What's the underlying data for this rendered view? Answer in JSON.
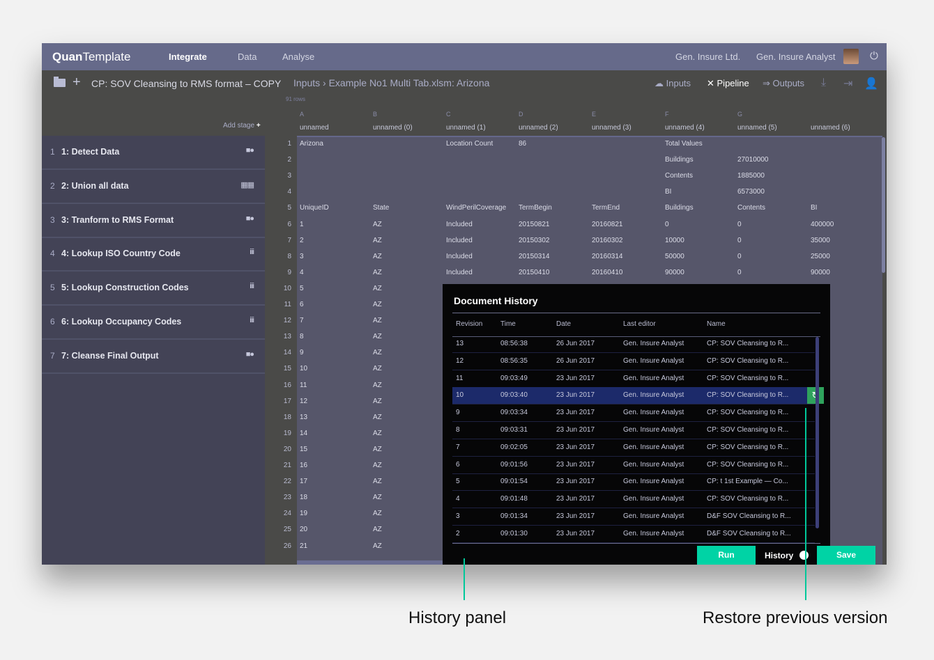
{
  "topbar": {
    "logo_bold": "Quan",
    "logo_light": "Template",
    "nav": [
      {
        "label": "Integrate",
        "active": true
      },
      {
        "label": "Data",
        "active": false
      },
      {
        "label": "Analyse",
        "active": false
      }
    ],
    "company": "Gen. Insure Ltd.",
    "user": "Gen. Insure Analyst",
    "power_icon": "power-icon"
  },
  "subbar": {
    "title": "CP: SOV Cleansing to RMS format – COPY",
    "breadcrumb": "Inputs › Example No1 Multi Tab.xlsm: Arizona",
    "tabs": [
      {
        "label": "Inputs",
        "icon": "cloud-upload-icon"
      },
      {
        "label": "Pipeline",
        "icon": "pipeline-icon",
        "active": true
      },
      {
        "label": "Outputs",
        "icon": "output-icon"
      }
    ]
  },
  "sidebar": {
    "add_stage": "Add stage",
    "stages": [
      {
        "num": "1",
        "label": "1: Detect Data",
        "icon": "transform-icon"
      },
      {
        "num": "2",
        "label": "2: Union all data",
        "icon": "union-icon"
      },
      {
        "num": "3",
        "label": "3: Tranform to RMS Format",
        "icon": "transform-icon"
      },
      {
        "num": "4",
        "label": "4: Lookup ISO Country Code",
        "icon": "lookup-icon"
      },
      {
        "num": "5",
        "label": "5: Lookup Construction Codes",
        "icon": "lookup-icon"
      },
      {
        "num": "6",
        "label": "6: Lookup Occupancy Codes",
        "icon": "lookup-icon"
      },
      {
        "num": "7",
        "label": "7: Cleanse Final Output",
        "icon": "transform-icon"
      }
    ]
  },
  "grid": {
    "row_count": "91 rows",
    "letters": [
      "A",
      "B",
      "C",
      "D",
      "E",
      "F",
      "G",
      ""
    ],
    "names": [
      "unnamed",
      "unnamed (0)",
      "unnamed (1)",
      "unnamed (2)",
      "unnamed (3)",
      "unnamed (4)",
      "unnamed (5)",
      "unnamed (6)"
    ],
    "rows": [
      [
        "Arizona",
        "",
        "Location Count",
        "86",
        "",
        "Total Values",
        "",
        ""
      ],
      [
        "",
        "",
        "",
        "",
        "",
        "Buildings",
        "27010000",
        ""
      ],
      [
        "",
        "",
        "",
        "",
        "",
        "Contents",
        "1885000",
        ""
      ],
      [
        "",
        "",
        "",
        "",
        "",
        "BI",
        "6573000",
        ""
      ],
      [
        "UniqueID",
        "State",
        "WindPerilCoverage",
        "TermBegin",
        "TermEnd",
        "Buildings",
        "Contents",
        "BI"
      ],
      [
        "1",
        "AZ",
        "Included",
        "20150821",
        "20160821",
        "0",
        "0",
        "400000"
      ],
      [
        "2",
        "AZ",
        "Included",
        "20150302",
        "20160302",
        "10000",
        "0",
        "35000"
      ],
      [
        "3",
        "AZ",
        "Included",
        "20150314",
        "20160314",
        "50000",
        "0",
        "25000"
      ],
      [
        "4",
        "AZ",
        "Included",
        "20150410",
        "20160410",
        "90000",
        "0",
        "90000"
      ],
      [
        "5",
        "AZ"
      ],
      [
        "6",
        "AZ"
      ],
      [
        "7",
        "AZ"
      ],
      [
        "8",
        "AZ"
      ],
      [
        "9",
        "AZ"
      ],
      [
        "10",
        "AZ"
      ],
      [
        "11",
        "AZ"
      ],
      [
        "12",
        "AZ"
      ],
      [
        "13",
        "AZ"
      ],
      [
        "14",
        "AZ"
      ],
      [
        "15",
        "AZ"
      ],
      [
        "16",
        "AZ"
      ],
      [
        "17",
        "AZ"
      ],
      [
        "18",
        "AZ"
      ],
      [
        "19",
        "AZ"
      ],
      [
        "20",
        "AZ"
      ],
      [
        "21",
        "AZ"
      ]
    ]
  },
  "history": {
    "title": "Document History",
    "headers": [
      "Revision",
      "Time",
      "Date",
      "Last editor",
      "Name"
    ],
    "rows": [
      {
        "rev": "13",
        "time": "08:56:38",
        "date": "26 Jun 2017",
        "editor": "Gen. Insure Analyst",
        "name": "CP: SOV Cleansing to R..."
      },
      {
        "rev": "12",
        "time": "08:56:35",
        "date": "26 Jun 2017",
        "editor": "Gen. Insure Analyst",
        "name": "CP: SOV Cleansing to R..."
      },
      {
        "rev": "11",
        "time": "09:03:49",
        "date": "23 Jun 2017",
        "editor": "Gen. Insure Analyst",
        "name": "CP: SOV Cleansing to R..."
      },
      {
        "rev": "10",
        "time": "09:03:40",
        "date": "23 Jun 2017",
        "editor": "Gen. Insure Analyst",
        "name": "CP: SOV Cleansing to R...",
        "selected": true
      },
      {
        "rev": "9",
        "time": "09:03:34",
        "date": "23 Jun 2017",
        "editor": "Gen. Insure Analyst",
        "name": "CP: SOV Cleansing to R..."
      },
      {
        "rev": "8",
        "time": "09:03:31",
        "date": "23 Jun 2017",
        "editor": "Gen. Insure Analyst",
        "name": "CP: SOV Cleansing to R..."
      },
      {
        "rev": "7",
        "time": "09:02:05",
        "date": "23 Jun 2017",
        "editor": "Gen. Insure Analyst",
        "name": "CP: SOV Cleansing to R..."
      },
      {
        "rev": "6",
        "time": "09:01:56",
        "date": "23 Jun 2017",
        "editor": "Gen. Insure Analyst",
        "name": "CP: SOV Cleansing to R..."
      },
      {
        "rev": "5",
        "time": "09:01:54",
        "date": "23 Jun 2017",
        "editor": "Gen. Insure Analyst",
        "name": "CP: t 1st Example — Co..."
      },
      {
        "rev": "4",
        "time": "09:01:48",
        "date": "23 Jun 2017",
        "editor": "Gen. Insure Analyst",
        "name": "CP: SOV Cleansing to R..."
      },
      {
        "rev": "3",
        "time": "09:01:34",
        "date": "23 Jun 2017",
        "editor": "Gen. Insure Analyst",
        "name": "D&F SOV Cleansing to R..."
      },
      {
        "rev": "2",
        "time": "09:01:30",
        "date": "23 Jun 2017",
        "editor": "Gen. Insure Analyst",
        "name": "D&F SOV Cleansing to R..."
      }
    ]
  },
  "footer": {
    "run": "Run",
    "history": "History",
    "save": "Save"
  },
  "callouts": {
    "history_panel": "History panel",
    "restore": "Restore previous version"
  },
  "colors": {
    "accent": "#00d3a5",
    "topbar": "#666a8a",
    "selected_row": "#1c2a6a",
    "restore": "#2fa35c"
  }
}
